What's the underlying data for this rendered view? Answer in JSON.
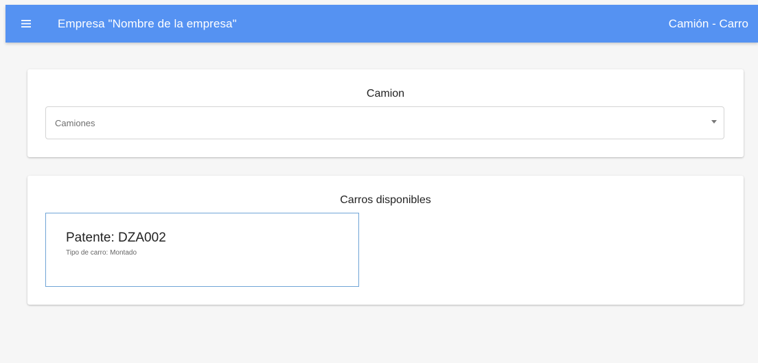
{
  "toolbar": {
    "menu_icon": "menu-icon",
    "title": "Empresa \"Nombre de la empresa\"",
    "section": "Camión - Carro",
    "color": "#5592f2"
  },
  "camion_card": {
    "title": "Camion",
    "select": {
      "placeholder": "Camiones",
      "arrow_icon": "dropdown-arrow-icon"
    }
  },
  "carros_card": {
    "title": "Carros disponibles",
    "items": [
      {
        "patente": "Patente: DZA002",
        "tipo": "Tipo de carro: Montado"
      }
    ]
  }
}
